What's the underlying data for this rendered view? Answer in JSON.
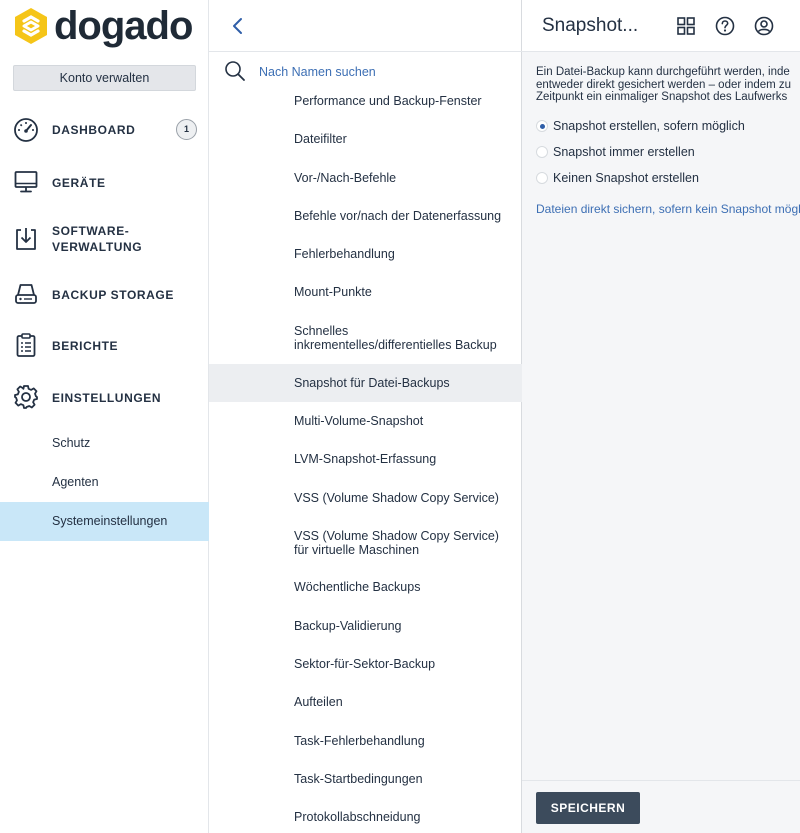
{
  "brand": {
    "name": "dogado",
    "logo_color": "#f5c518"
  },
  "sidebar": {
    "account_button": "Konto verwalten",
    "items": [
      {
        "label": "DASHBOARD",
        "icon": "gauge-icon",
        "badge": "1"
      },
      {
        "label": "GERÄTE",
        "icon": "monitor-icon"
      },
      {
        "label_line1": "SOFTWARE-",
        "label_line2": "VERWALTUNG",
        "icon": "software-download-icon"
      },
      {
        "label": "BACKUP STORAGE",
        "icon": "hard-drive-icon"
      },
      {
        "label": "BERICHTE",
        "icon": "clipboard-icon"
      },
      {
        "label": "EINSTELLUNGEN",
        "icon": "gear-icon"
      }
    ],
    "sub_items": [
      {
        "label": "Schutz"
      },
      {
        "label": "Agenten"
      },
      {
        "label": "Systemeinstellungen",
        "active": true
      }
    ]
  },
  "middle": {
    "search": {
      "placeholder": "Nach Namen suchen"
    },
    "items": [
      "Performance und Backup-Fenster",
      "Dateifilter",
      "Vor-/Nach-Befehle",
      "Befehle vor/nach der Datenerfassung",
      "Fehlerbehandlung",
      "Mount-Punkte",
      "Schnelles inkrementelles/differentielles Backup",
      "Snapshot für Datei-Backups",
      "Multi-Volume-Snapshot",
      "LVM-Snapshot-Erfassung",
      "VSS (Volume Shadow Copy Service)",
      "VSS (Volume Shadow Copy Service) für virtuelle Maschinen",
      "Wöchentliche Backups",
      "Backup-Validierung",
      "Sektor-für-Sektor-Backup",
      "Aufteilen",
      "Task-Fehlerbehandlung",
      "Task-Startbedingungen",
      "Protokollabschneidung"
    ],
    "active_index": 7
  },
  "detail": {
    "title": "Snapshot...",
    "description": "Ein Datei-Backup kann durchgeführt werden, inde\nentweder direkt gesichert werden – oder indem zu\nZeitpunkt ein einmaliger Snapshot des Laufwerks",
    "options": [
      {
        "label": "Snapshot erstellen, sofern möglich",
        "checked": true
      },
      {
        "label": "Snapshot immer erstellen",
        "checked": false
      },
      {
        "label": "Keinen Snapshot erstellen",
        "checked": false
      }
    ],
    "link": "Dateien direkt sichern, sofern kein Snapshot mögl",
    "save_button": "SPEICHERN"
  }
}
